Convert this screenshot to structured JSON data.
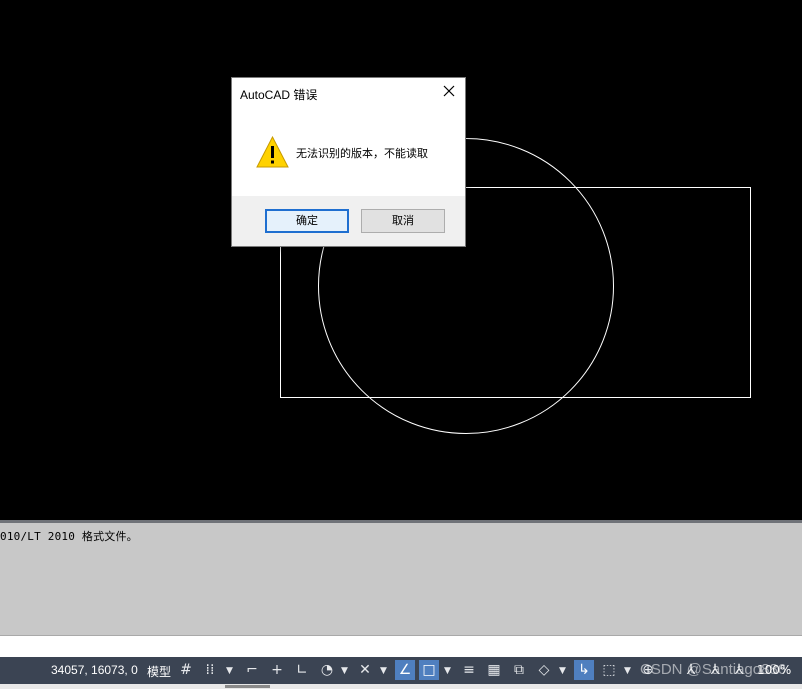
{
  "dialog": {
    "title": "AutoCAD 错误",
    "message": "无法识别的版本，不能读取",
    "ok_label": "确定",
    "cancel_label": "取消",
    "close_icon": "close-icon",
    "warning_icon": "warning-icon"
  },
  "command_history": {
    "line": "010/LT 2010 格式文件。"
  },
  "statusbar": {
    "coordinates": "34057, 16073, 0",
    "model_label": "模型",
    "zoom_partial": "100%",
    "watermark": "CSDN @Santiago886",
    "icons": [
      "grid-icon",
      "snap-icon",
      "infer-constraints-icon",
      "dynamic-input-icon",
      "ortho-icon",
      "polar-icon",
      "isodraft-icon",
      "object-snap-tracking-icon",
      "object-snap-icon",
      "lineweight-icon",
      "transparency-icon",
      "selection-cycling-icon",
      "3d-object-snap-icon",
      "dynamic-ucs-icon",
      "selection-filter-icon",
      "gizmo-icon",
      "annotation-visibility-icon",
      "auto-scale-icon",
      "annotation-scale-icon"
    ]
  },
  "colors": {
    "canvas": "#000000",
    "statusbar": "#3b4453",
    "command_panel": "#c8c8c8",
    "accent": "#1f6fd0"
  }
}
